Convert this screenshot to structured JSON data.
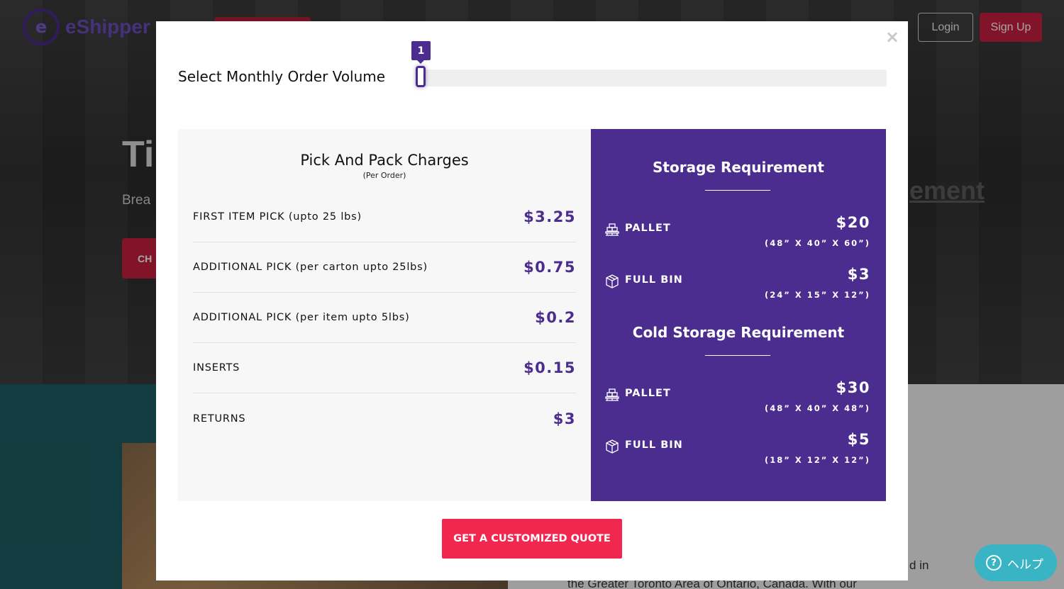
{
  "background": {
    "logo_text": "eShipper",
    "login_label": "Login",
    "signup_label": "Sign Up",
    "hero_title": "Ti",
    "hero_subtitle": "Brea",
    "hero_button": "CH",
    "hero_right_word": "ement",
    "body_text_1": "d in",
    "body_text_2": "the Greater Toronto Area of Ontario, Canada. With our"
  },
  "help": {
    "label": "ヘルプ",
    "icon": "question-icon"
  },
  "modal": {
    "close_label": "×",
    "volume_label": "Select Monthly Order Volume",
    "volume_value": "1",
    "volume_fraction": 0.0,
    "pick_pack": {
      "title": "Pick And Pack Charges",
      "subtitle": "(Per Order)",
      "rows": [
        {
          "label": "FIRST ITEM PICK (upto 25 lbs)",
          "value": "$3.25"
        },
        {
          "label": "ADDITIONAL PICK (per carton upto 25lbs)",
          "value": "$0.75"
        },
        {
          "label": "ADDITIONAL PICK (per item upto 5lbs)",
          "value": "$0.2"
        },
        {
          "label": "INSERTS",
          "value": "$0.15"
        },
        {
          "label": "RETURNS",
          "value": "$3"
        }
      ]
    },
    "storage": {
      "title": "Storage Requirement",
      "rows": [
        {
          "icon": "pallet-icon",
          "label": "PALLET",
          "price": "$20",
          "dims": "(48” X 40” X 60”)"
        },
        {
          "icon": "box-icon",
          "label": "FULL BIN",
          "price": "$3",
          "dims": "(24” X 15” X 12”)"
        }
      ]
    },
    "cold_storage": {
      "title": "Cold Storage Requirement",
      "rows": [
        {
          "icon": "pallet-icon",
          "label": "PALLET",
          "price": "$30",
          "dims": "(48” X 40” X 48”)"
        },
        {
          "icon": "box-icon",
          "label": "FULL BIN",
          "price": "$5",
          "dims": "(18” X 12” X 12”)"
        }
      ]
    },
    "quote_button": "GET A CUSTOMIZED QUOTE"
  },
  "colors": {
    "accent_purple": "#4a2d8f",
    "cta_pink": "#f0284f",
    "help_teal": "#38b4c4"
  }
}
